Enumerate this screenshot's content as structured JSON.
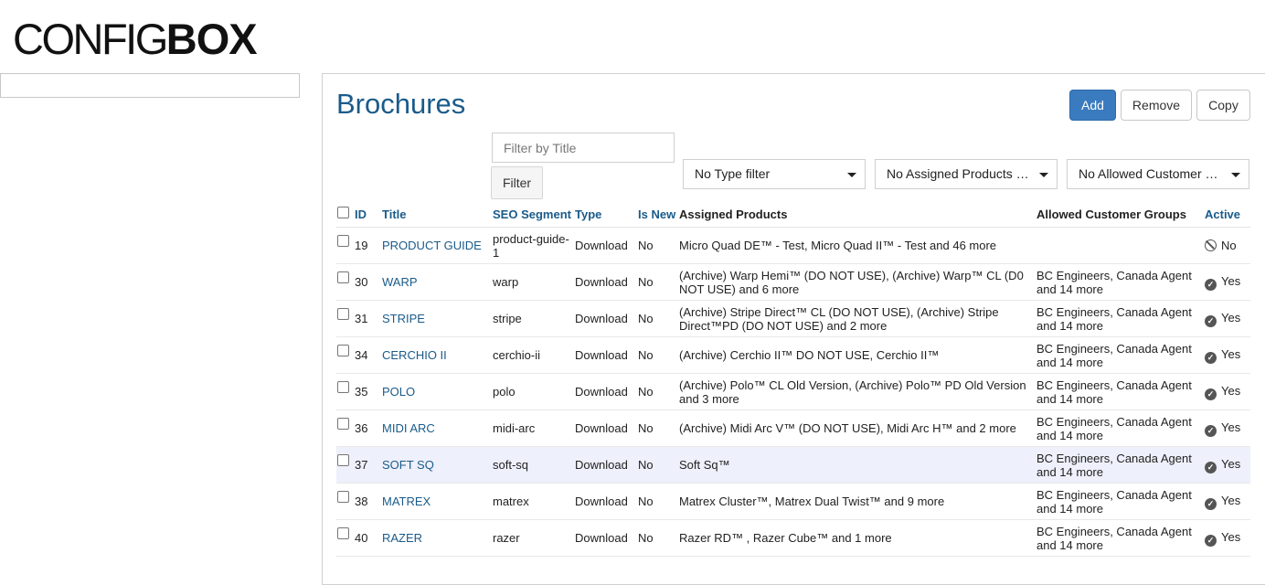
{
  "logo": {
    "light": "CONFIG",
    "bold": "BOX"
  },
  "page": {
    "title": "Brochures"
  },
  "toolbar": {
    "add": "Add",
    "remove": "Remove",
    "copy": "Copy"
  },
  "filters": {
    "title_placeholder": "Filter by Title",
    "filter_button": "Filter",
    "type": "No Type filter",
    "products": "No Assigned Products f…",
    "customers": "No Allowed Customer …"
  },
  "columns": {
    "id": "ID",
    "title": "Title",
    "seo": "SEO Segment",
    "type": "Type",
    "is_new": "Is New",
    "products": "Assigned Products",
    "groups": "Allowed Customer Groups",
    "active": "Active"
  },
  "rows": [
    {
      "id": "19",
      "title": "PRODUCT GUIDE",
      "seo": "product-guide-1",
      "type": "Download",
      "is_new": "No",
      "products": "Micro Quad DE™ - Test, Micro Quad II™ - Test and 46 more",
      "groups": "",
      "active": "No"
    },
    {
      "id": "30",
      "title": "WARP",
      "seo": "warp",
      "type": "Download",
      "is_new": "No",
      "products": "(Archive) Warp Hemi™ (DO NOT USE), (Archive) Warp™ CL (D0 NOT USE) and 6 more",
      "groups": "BC Engineers, Canada Agent and 14 more",
      "active": "Yes"
    },
    {
      "id": "31",
      "title": "STRIPE",
      "seo": "stripe",
      "type": "Download",
      "is_new": "No",
      "products": "(Archive) Stripe Direct™ CL (DO NOT USE), (Archive) Stripe Direct™PD (DO NOT USE) and 2 more",
      "groups": "BC Engineers, Canada Agent and 14 more",
      "active": "Yes"
    },
    {
      "id": "34",
      "title": "CERCHIO II",
      "seo": "cerchio-ii",
      "type": "Download",
      "is_new": "No",
      "products": "(Archive) Cerchio II™ DO NOT USE, Cerchio II™",
      "groups": "BC Engineers, Canada Agent and 14 more",
      "active": "Yes"
    },
    {
      "id": "35",
      "title": "POLO",
      "seo": "polo",
      "type": "Download",
      "is_new": "No",
      "products": "(Archive) Polo™ CL Old Version, (Archive) Polo™ PD Old Version and 3 more",
      "groups": "BC Engineers, Canada Agent and 14 more",
      "active": "Yes"
    },
    {
      "id": "36",
      "title": "MIDI ARC",
      "seo": "midi-arc",
      "type": "Download",
      "is_new": "No",
      "products": "(Archive) Midi Arc V™ (DO NOT USE), Midi Arc H™ and 2 more",
      "groups": "BC Engineers, Canada Agent and 14 more",
      "active": "Yes"
    },
    {
      "id": "37",
      "title": "SOFT SQ",
      "seo": "soft-sq",
      "type": "Download",
      "is_new": "No",
      "products": "Soft Sq™",
      "groups": "BC Engineers, Canada Agent and 14 more",
      "active": "Yes"
    },
    {
      "id": "38",
      "title": "MATREX",
      "seo": "matrex",
      "type": "Download",
      "is_new": "No",
      "products": "Matrex Cluster™, Matrex Dual Twist™ and 9 more",
      "groups": "BC Engineers, Canada Agent and 14 more",
      "active": "Yes"
    },
    {
      "id": "40",
      "title": "RAZER",
      "seo": "razer",
      "type": "Download",
      "is_new": "No",
      "products": "Razer RD™ , Razer Cube™ and 1 more",
      "groups": "BC Engineers, Canada Agent and 14 more",
      "active": "Yes"
    }
  ],
  "highlighted_row_index": 6
}
